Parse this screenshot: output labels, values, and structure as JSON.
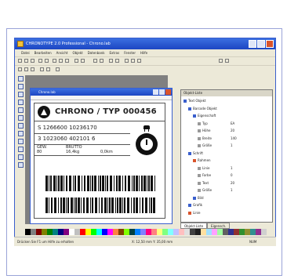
{
  "window": {
    "title": "CHRONOTYPE 2.0 Professional - Chrono.lab"
  },
  "menu": [
    "Datei",
    "Bearbeiten",
    "Ansicht",
    "Objekt",
    "Datenbank",
    "Extras",
    "Fenster",
    "Hilfe"
  ],
  "document": {
    "title": "Chrono.lab"
  },
  "label": {
    "header": "CHRONO / TYP 000456",
    "row1": "S 1266600 10236170",
    "row2": "3 1023060 402101 6",
    "row3_a": "GEW.",
    "row3_b": "BRUTTO",
    "row3_val_a": "80",
    "row3_val_b": "16,4kg",
    "row3_val_c": "0,0km"
  },
  "right_panel": {
    "title": "Objekt-Liste",
    "tree": [
      {
        "label": "Text Objekt",
        "value": "",
        "indent": 0,
        "color": "#3a5fcd"
      },
      {
        "label": "Barcode Objekt",
        "value": "",
        "indent": 1,
        "color": "#3a5fcd"
      },
      {
        "label": "Eigenschaft",
        "value": "",
        "indent": 2,
        "color": "#3a5fcd"
      },
      {
        "label": "Typ",
        "value": "EA",
        "indent": 3,
        "color": "#999999"
      },
      {
        "label": "Höhe",
        "value": "20",
        "indent": 3,
        "color": "#999999"
      },
      {
        "label": "Breite",
        "value": "140",
        "indent": 3,
        "color": "#999999"
      },
      {
        "label": "Größe",
        "value": "1",
        "indent": 3,
        "color": "#999999"
      },
      {
        "label": "Schrift",
        "value": "",
        "indent": 1,
        "color": "#3a5fcd"
      },
      {
        "label": "Rahmen",
        "value": "",
        "indent": 2,
        "color": "#d9542b"
      },
      {
        "label": "Linie",
        "value": "1",
        "indent": 3,
        "color": "#999999"
      },
      {
        "label": "Farbe",
        "value": "0",
        "indent": 3,
        "color": "#999999"
      },
      {
        "label": "Text",
        "value": "20",
        "indent": 3,
        "color": "#999999"
      },
      {
        "label": "Größe",
        "value": "1",
        "indent": 3,
        "color": "#999999"
      },
      {
        "label": "Bild",
        "value": "",
        "indent": 2,
        "color": "#3a5fcd"
      },
      {
        "label": "Grafik",
        "value": "",
        "indent": 1,
        "color": "#3a5fcd"
      },
      {
        "label": "Linie",
        "value": "",
        "indent": 1,
        "color": "#d9542b"
      }
    ],
    "tabs": [
      "Objekt-Liste",
      "Eigensch."
    ]
  },
  "palette": [
    "#000000",
    "#808080",
    "#800000",
    "#808000",
    "#008000",
    "#008080",
    "#000080",
    "#800080",
    "#ffffff",
    "#c0c0c0",
    "#ff0000",
    "#ffff00",
    "#00ff00",
    "#00ffff",
    "#0000ff",
    "#ff00ff",
    "#ff8040",
    "#804000",
    "#80ff00",
    "#004040",
    "#0080ff",
    "#8080ff",
    "#ff0080",
    "#ff8080",
    "#ffff80",
    "#80ff80",
    "#80ffff",
    "#c0c0ff",
    "#ffc0c0",
    "#e0e0e0",
    "#404040",
    "#202020",
    "#ffe0a0",
    "#a0e0ff",
    "#ffa0ff",
    "#a0ffa0",
    "#606060",
    "#303090",
    "#903030",
    "#309030",
    "#909030",
    "#309090",
    "#903090",
    "#d0d0d0"
  ],
  "status": {
    "left": "Drücken Sie F1 um Hilfe zu erhalten",
    "middle": "X: 12,50 mm  Y: 35,00 mm",
    "right": "NUM"
  },
  "colors": {
    "accent": "#3a5fcd",
    "titlebar": "#1c46c3",
    "close": "#d9542b"
  }
}
